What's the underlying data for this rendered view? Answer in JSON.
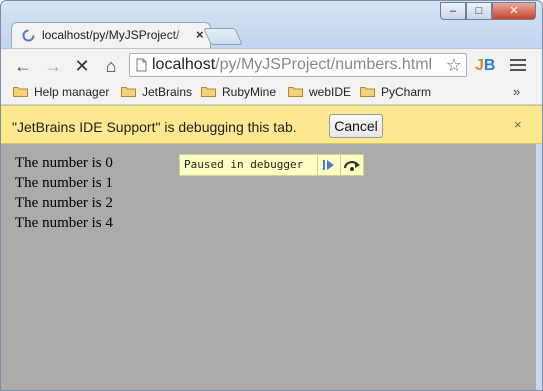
{
  "tab": {
    "title": "localhost/py/MyJSProject/",
    "close_glyph": "×"
  },
  "window_controls": {
    "minimize": "‒",
    "maximize": "□",
    "close": "✕"
  },
  "toolbar": {
    "url_host": "localhost",
    "url_path": "/py/MyJSProject/numbers.html",
    "back_glyph": "←",
    "forward_glyph": "→",
    "stop_glyph": "✕",
    "home_glyph": "⌂",
    "star_glyph": "☆",
    "jb_label": "JB"
  },
  "bookmarks": {
    "items": [
      "Help manager",
      "JetBrains",
      "RubyMine",
      "webIDE",
      "PyCharm"
    ],
    "more_glyph": "»"
  },
  "infobar": {
    "message": "\"JetBrains IDE Support\" is debugging this tab.",
    "cancel_label": "Cancel",
    "close_glyph": "×"
  },
  "page": {
    "lines": [
      "The number is 0",
      "The number is 1",
      "The number is 2",
      "The number is 4"
    ]
  },
  "debugger": {
    "label": "Paused in debugger"
  },
  "colors": {
    "infobar_bg": "#fce98f",
    "content_bg": "#ababab",
    "debugger_bg": "#ffffc2",
    "resume_icon": "#3c7be0"
  }
}
